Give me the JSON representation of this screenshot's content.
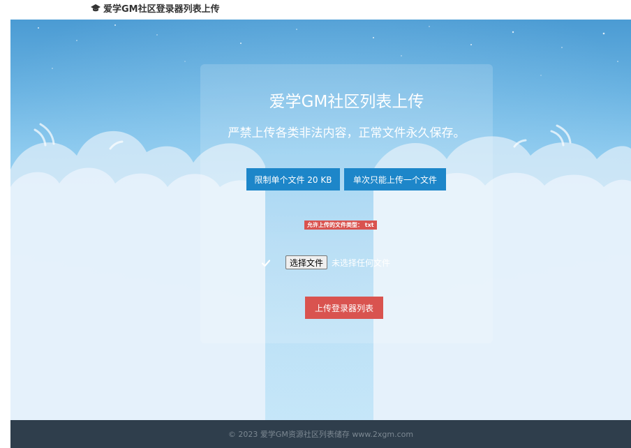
{
  "header": {
    "brand_icon": "graduation-cap-icon",
    "brand_text": "爱学GM社区登录器列表上传"
  },
  "panel": {
    "title": "爱学GM社区列表上传",
    "subtitle": "严禁上传各类非法内容，正常文件永久保存。",
    "limit_size_label": "限制单个文件 20 KB",
    "limit_count_label": "单次只能上传一个文件",
    "allowed_types_badge": "允许上传的文件类型： txt",
    "file_input": {
      "button_label": "选择文件",
      "status": "未选择任何文件",
      "status_icon": "check-icon"
    },
    "submit_label": "上传登录器列表"
  },
  "footer": {
    "copyright": "© 2023 爱学GM资源社区列表储存 www.2xgm.com"
  },
  "colors": {
    "info_button": "#1d86c9",
    "danger": "#d9534f",
    "footer_bg": "#2f3e4c",
    "sky_top": "#4b9bd3",
    "sky_bottom": "#c7e7f9"
  }
}
